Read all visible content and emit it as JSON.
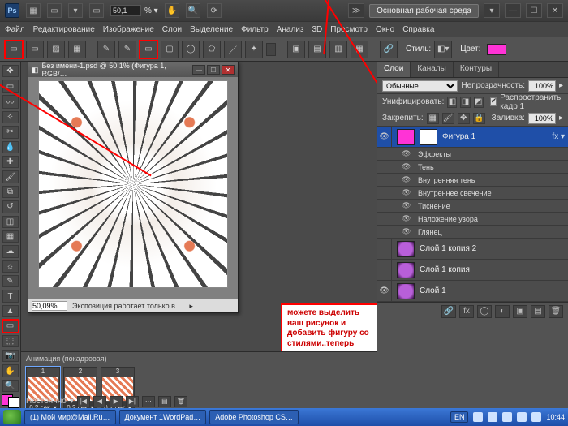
{
  "header": {
    "zoom_value": "50,1",
    "workspace": "Основная рабочая среда"
  },
  "menu": [
    "Файл",
    "Редактирование",
    "Изображение",
    "Слои",
    "Выделение",
    "Фильтр",
    "Анализ",
    "3D",
    "Просмотр",
    "Окно",
    "Справка"
  ],
  "options": {
    "style_label": "Стиль:",
    "color_label": "Цвет:",
    "color_hex": "#ff33d6"
  },
  "document": {
    "title": "Без имени-1.psd @ 50,1% (Фигура 1, RGB/…",
    "status_zoom": "50,09%",
    "status_text": "Экспозиция работает только в …"
  },
  "callout": "можете выделить ваш рисунок и добавить фигуру со стилями..теперь переходим на второй кадр",
  "animation": {
    "title": "Анимация (покадровая)",
    "loop_label": "Постоянно",
    "frames": [
      {
        "n": "1",
        "dur": "0,2 сек."
      },
      {
        "n": "2",
        "dur": "0,2 сек."
      },
      {
        "n": "3",
        "dur": "0,2 сек."
      }
    ]
  },
  "layers_panel": {
    "tabs": [
      "Слои",
      "Каналы",
      "Контуры"
    ],
    "blend_mode": "Обычные",
    "opacity_label": "Непрозрачность:",
    "opacity_value": "100%",
    "unify_label": "Унифицировать:",
    "propagate_label": "Распространить кадр 1",
    "lock_label": "Закрепить:",
    "fill_label": "Заливка:",
    "fill_value": "100%",
    "layers": [
      {
        "name": "Фигура 1",
        "selected": true,
        "thumb": "magenta",
        "effects_label": "Эффекты",
        "effects": [
          "Тень",
          "Внутренняя тень",
          "Внутреннее свечение",
          "Тиснение",
          "Наложение узора",
          "Глянец"
        ]
      },
      {
        "name": "Слой 1 копия 2",
        "thumb": "star"
      },
      {
        "name": "Слой 1 копия",
        "thumb": "star"
      },
      {
        "name": "Слой 1",
        "thumb": "star"
      }
    ]
  },
  "taskbar": {
    "items": [
      "(1) Мой мир@Mail.Ru…",
      "Документ 1WordPad…",
      "Adobe Photoshop CS…"
    ],
    "lang": "EN",
    "time": "10:44"
  }
}
